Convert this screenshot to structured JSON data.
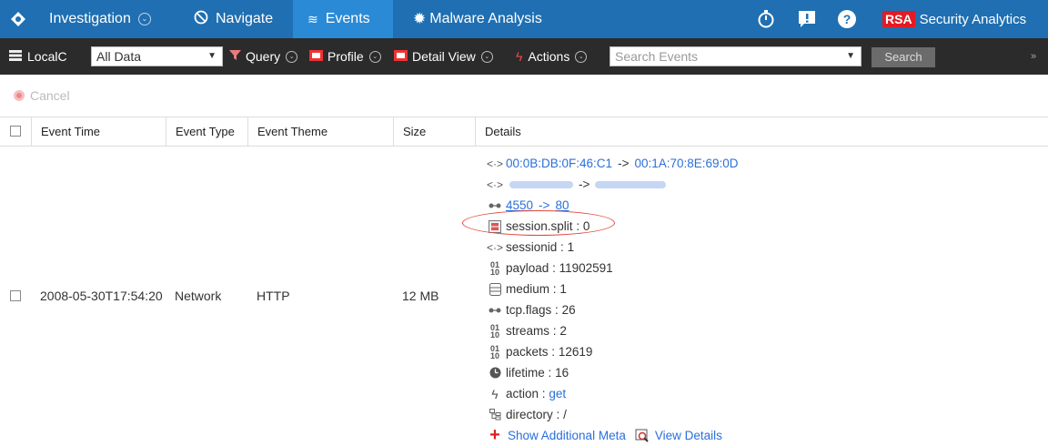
{
  "header": {
    "tabs": [
      {
        "label": "Investigation",
        "icon": "crosshair-icon"
      },
      {
        "label": "Navigate",
        "icon": "compass-icon"
      },
      {
        "label": "Events",
        "icon": "layers-icon"
      },
      {
        "label": "Malware Analysis",
        "icon": "bug-icon"
      }
    ],
    "brand": {
      "logo": "RSA",
      "name": "Security Analytics"
    },
    "colors": {
      "topbar": "#1f6fb2",
      "active_tab": "#2a8ad6",
      "brand_red": "#e31b23"
    }
  },
  "toolbar": {
    "source": "LocalC",
    "data_select": "All Data",
    "query": "Query",
    "profile": "Profile",
    "detail_view": "Detail View",
    "actions": "Actions",
    "search_placeholder": "Search Events",
    "search_button": "Search",
    "more": "»"
  },
  "cancel_label": "Cancel",
  "table": {
    "columns": [
      "Event Time",
      "Event Type",
      "Event Theme",
      "Size",
      "Details"
    ],
    "row": {
      "event_time": "2008-05-30T17:54:20",
      "event_type": "Network",
      "event_theme": "HTTP",
      "size": "12 MB"
    }
  },
  "details": {
    "mac_src": "00:0B:DB:0F:46:C1",
    "mac_dst": "00:1A:70:8E:69:0D",
    "arrow": "->",
    "port_src": "4550",
    "port_dst": "80",
    "meta": [
      {
        "key": "session.split",
        "value": "0",
        "icon": "session-split-icon"
      },
      {
        "key": "sessionid",
        "value": "1",
        "icon": "link-arrows-icon"
      },
      {
        "key": "payload",
        "value": "11902591",
        "icon": "binary-icon"
      },
      {
        "key": "medium",
        "value": "1",
        "icon": "database-icon"
      },
      {
        "key": "tcp.flags",
        "value": "26",
        "icon": "connection-icon"
      },
      {
        "key": "streams",
        "value": "2",
        "icon": "binary-icon"
      },
      {
        "key": "packets",
        "value": "12619",
        "icon": "binary-icon"
      },
      {
        "key": "lifetime",
        "value": "16",
        "icon": "clock-icon"
      },
      {
        "key": "action",
        "value": "get",
        "icon": "lightning-icon"
      },
      {
        "key": "directory",
        "value": "/",
        "icon": "tree-icon"
      }
    ],
    "separator": ":",
    "show_more": "Show Additional Meta",
    "view_details": "View Details"
  }
}
